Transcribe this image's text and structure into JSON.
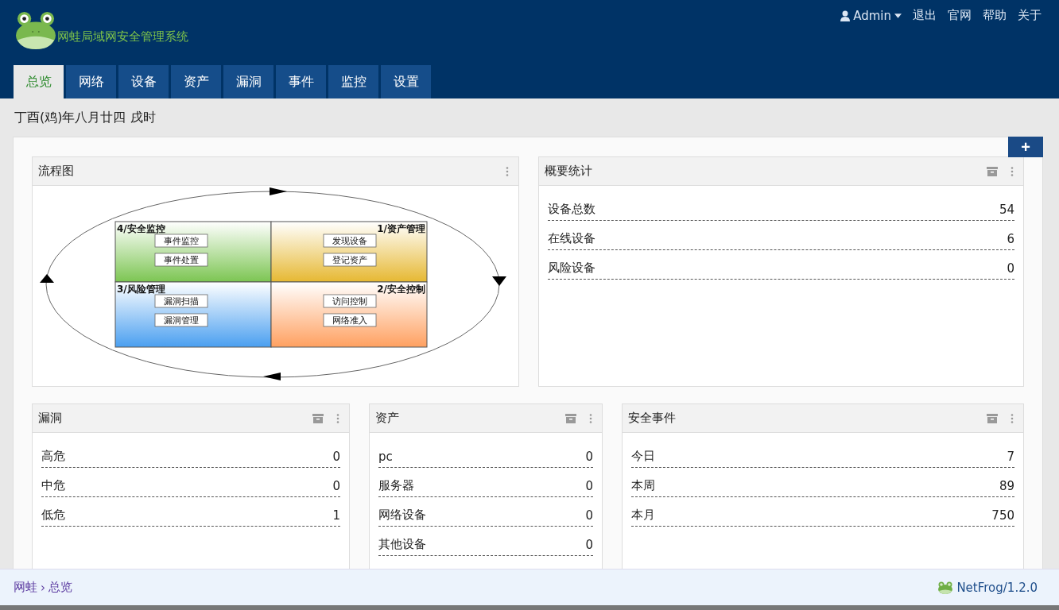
{
  "header": {
    "logo_text": "网蛙局域网安全管理系统",
    "user": "Admin",
    "links": [
      "退出",
      "官网",
      "帮助",
      "关于"
    ]
  },
  "tabs": [
    {
      "label": "总览",
      "selected": true
    },
    {
      "label": "网络",
      "selected": false
    },
    {
      "label": "设备",
      "selected": false
    },
    {
      "label": "资产",
      "selected": false
    },
    {
      "label": "漏洞",
      "selected": false
    },
    {
      "label": "事件",
      "selected": false
    },
    {
      "label": "监控",
      "selected": false
    },
    {
      "label": "设置",
      "selected": false
    }
  ],
  "date": "丁酉(鸡)年八月廿四 戌时",
  "add_button": "+",
  "panel_rows": [
    [
      {
        "title": "流程图",
        "kind": "diagram",
        "quadrants": [
          {
            "title": "4/安全监控",
            "color": "#7cc552",
            "items": [
              "事件监控",
              "事件处置"
            ]
          },
          {
            "title": "1/资产管理",
            "color": "#e6b832",
            "items": [
              "发现设备",
              "登记资产"
            ]
          },
          {
            "title": "3/风险管理",
            "color": "#4a9ff0",
            "items": [
              "漏洞扫描",
              "漏洞管理"
            ]
          },
          {
            "title": "2/安全控制",
            "color": "#ffa060",
            "items": [
              "访问控制",
              "网络准入"
            ]
          }
        ]
      },
      {
        "title": "概要统计",
        "kind": "stats",
        "rows": [
          {
            "label": "设备总数",
            "value": "54"
          },
          {
            "label": "在线设备",
            "value": "6"
          },
          {
            "label": "风险设备",
            "value": "0"
          }
        ]
      }
    ],
    [
      {
        "title": "漏洞",
        "kind": "stats",
        "rows": [
          {
            "label": "高危",
            "value": "0"
          },
          {
            "label": "中危",
            "value": "0"
          },
          {
            "label": "低危",
            "value": "1"
          }
        ]
      },
      {
        "title": "资产",
        "kind": "stats",
        "rows": [
          {
            "label": "pc",
            "value": "0"
          },
          {
            "label": "服务器",
            "value": "0"
          },
          {
            "label": "网络设备",
            "value": "0"
          },
          {
            "label": "其他设备",
            "value": "0"
          }
        ]
      },
      {
        "title": "安全事件",
        "kind": "stats",
        "rows": [
          {
            "label": "今日",
            "value": "7"
          },
          {
            "label": "本周",
            "value": "89"
          },
          {
            "label": "本月",
            "value": "750"
          }
        ]
      }
    ]
  ],
  "footer": {
    "breadcrumb": [
      "网蛙",
      "总览"
    ],
    "separator": "›",
    "version": "NetFrog/1.2.0"
  }
}
